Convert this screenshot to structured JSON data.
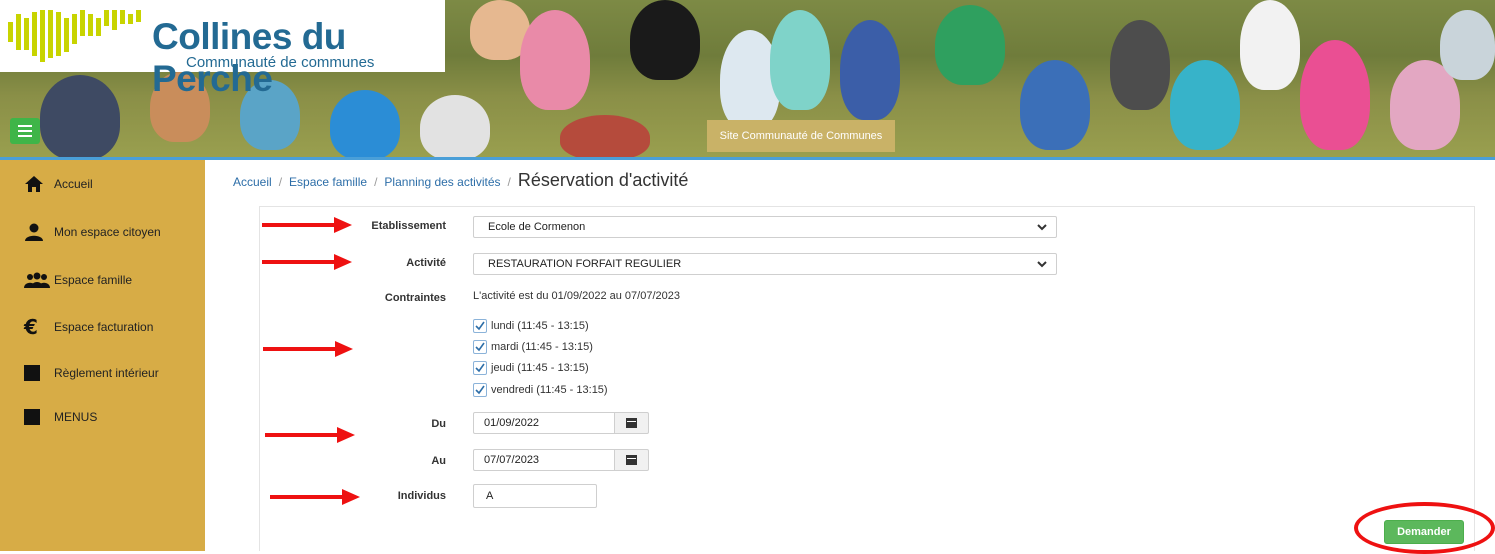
{
  "header": {
    "logo_title": "Collines du Perche",
    "logo_subtitle": "Communauté de communes",
    "site_button": "Site Communauté de Communes",
    "accent_green": "#3fb548",
    "brand_blue": "#236a93"
  },
  "sidebar": {
    "background": "#d7ac46",
    "items": [
      {
        "label": "Accueil",
        "icon": "home-icon"
      },
      {
        "label": "Mon espace citoyen",
        "icon": "user-icon"
      },
      {
        "label": "Espace famille",
        "icon": "family-icon"
      },
      {
        "label": "Espace facturation",
        "icon": "euro-icon"
      },
      {
        "label": "Règlement intérieur",
        "icon": "square-icon"
      },
      {
        "label": "MENUS",
        "icon": "square-icon"
      }
    ]
  },
  "breadcrumb": {
    "items": [
      "Accueil",
      "Espace famille",
      "Planning des activités"
    ],
    "separator": "/",
    "current": "Réservation d'activité"
  },
  "form": {
    "etablissement_label": "Etablissement",
    "etablissement_value": "Ecole de Cormenon",
    "activite_label": "Activité",
    "activite_value": "RESTAURATION FORFAIT REGULIER",
    "contraintes_label": "Contraintes",
    "contraintes_info": "L'activité est du 01/09/2022 au 07/07/2023",
    "days": [
      {
        "label": "lundi (11:45 - 13:15)",
        "checked": true
      },
      {
        "label": "mardi (11:45 - 13:15)",
        "checked": true
      },
      {
        "label": "jeudi (11:45 - 13:15)",
        "checked": true
      },
      {
        "label": "vendredi (11:45 - 13:15)",
        "checked": true
      }
    ],
    "du_label": "Du",
    "du_value": "01/09/2022",
    "au_label": "Au",
    "au_value": "07/07/2023",
    "individus_label": "Individus",
    "individus_value": "A",
    "submit_label": "Demander",
    "submit_color": "#5cb85c"
  },
  "annotations": {
    "arrow_color": "#ee1111"
  }
}
